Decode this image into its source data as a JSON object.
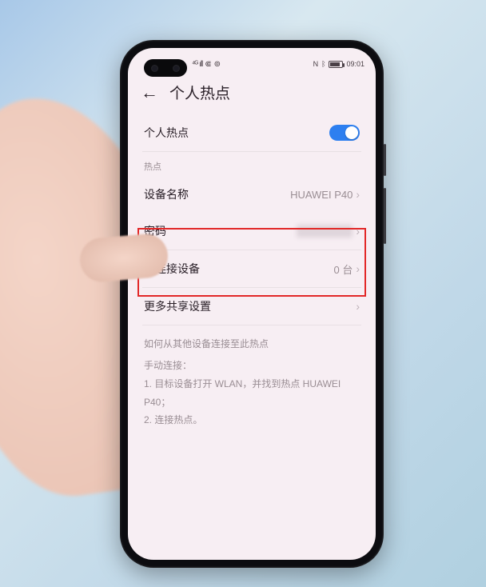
{
  "status": {
    "nfc": "N",
    "bt": "ᛒ",
    "battery_text": "",
    "time": "09:01"
  },
  "header": {
    "title": "个人热点"
  },
  "hotspot_toggle": {
    "label": "个人热点",
    "on": true
  },
  "section_hotspot_label": "热点",
  "rows": {
    "device_name": {
      "label": "设备名称",
      "value": "HUAWEI P40"
    },
    "password": {
      "label": "密码",
      "value": ""
    },
    "connected": {
      "label": "已连接设备",
      "value": "0 台"
    },
    "more_share": {
      "label": "更多共享设置"
    }
  },
  "info": {
    "title": "如何从其他设备连接至此热点",
    "sub": "手动连接：",
    "step1": "1. 目标设备打开 WLAN，并找到热点 HUAWEI P40；",
    "step2": "2. 连接热点。"
  }
}
